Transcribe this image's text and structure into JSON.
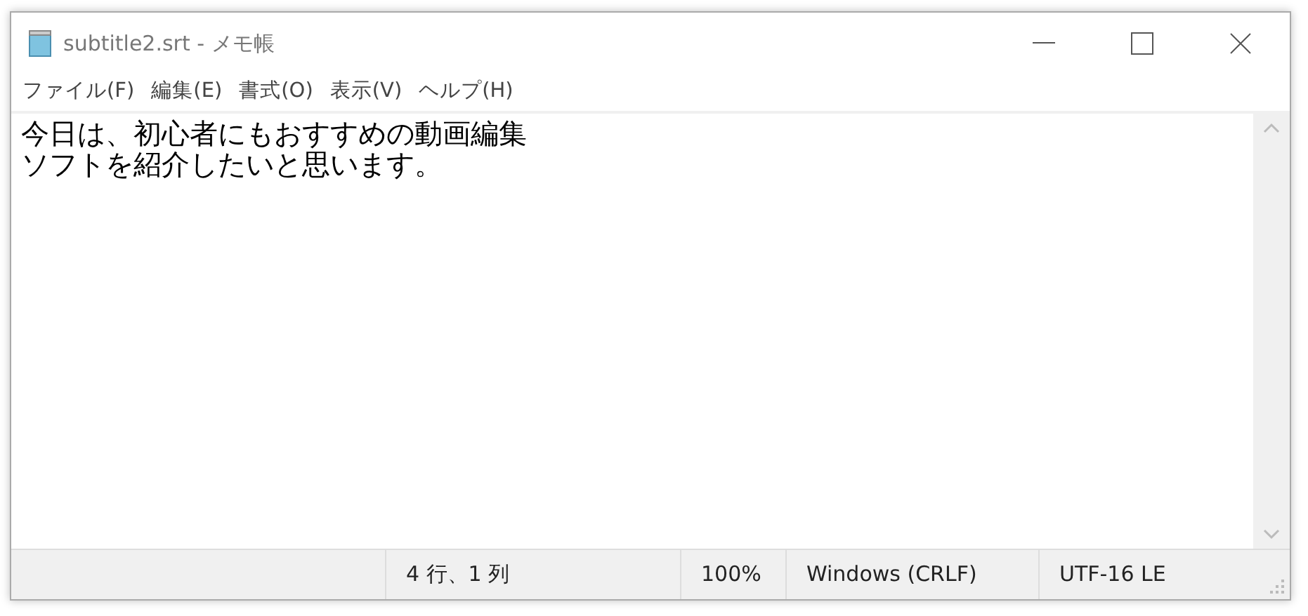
{
  "window": {
    "title": "subtitle2.srt - メモ帳"
  },
  "menu": [
    "ファイル(F)",
    "編集(E)",
    "書式(O)",
    "表示(V)",
    "ヘルプ(H)"
  ],
  "editor": {
    "lines": [
      "今日は、初心者にもおすすめの動画編集",
      "ソフトを紹介したいと思います。"
    ]
  },
  "status_bar": {
    "position": "4 行、1 列",
    "zoom": "100%",
    "line_ending": "Windows (CRLF)",
    "encoding": "UTF-16 LE"
  }
}
